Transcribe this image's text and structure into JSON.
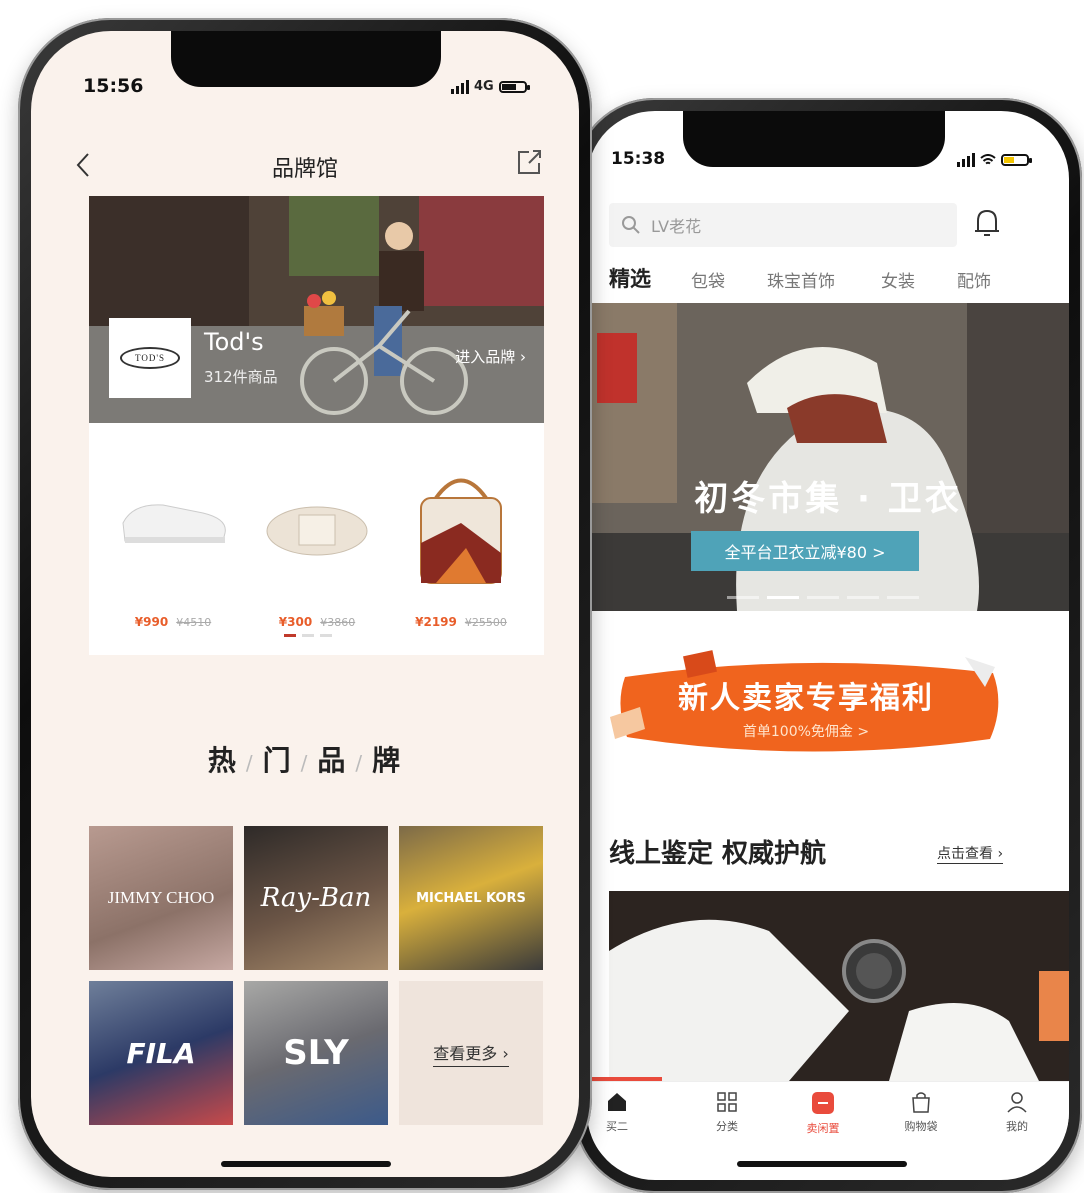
{
  "phone1": {
    "status": {
      "time": "15:56",
      "network": "4G"
    },
    "nav": {
      "title": "品牌馆"
    },
    "featured_brand": {
      "logo_text": "TOD'S",
      "name": "Tod's",
      "count": "312件商品",
      "enter_label": "进入品牌 ›"
    },
    "products": [
      {
        "price": "¥990",
        "original": "¥4510"
      },
      {
        "price": "¥300",
        "original": "¥3860"
      },
      {
        "price": "¥2199",
        "original": "¥25500"
      }
    ],
    "hot_brands_title": [
      "热",
      "门",
      "品",
      "牌"
    ],
    "brands": [
      {
        "label": "JIMMY CHOO"
      },
      {
        "label": "Ray-Ban"
      },
      {
        "label": "MICHAEL KORS"
      },
      {
        "label": "FILA"
      },
      {
        "label": "SLY"
      }
    ],
    "see_more": "查看更多 ›"
  },
  "phone2": {
    "status": {
      "time": "15:38"
    },
    "search": {
      "placeholder": "LV老花"
    },
    "tabs": [
      "精选",
      "包袋",
      "珠宝首饰",
      "女装",
      "配饰"
    ],
    "hero": {
      "title": "初冬市集 · 卫衣",
      "button": "全平台卫衣立减¥80 >"
    },
    "promo": {
      "title": "新人卖家专享福利",
      "subtitle": "首单100%免佣金 >"
    },
    "section": {
      "title": "线上鉴定 权威护航",
      "link": "点击查看 ›"
    },
    "tabbar": [
      "买二",
      "分类",
      "卖闲置",
      "购物袋",
      "我的"
    ]
  },
  "colors": {
    "accent": "#e94b3c",
    "price": "#e85d2a",
    "hero_button": "#4fa3b8",
    "promo": "#f0641e"
  }
}
